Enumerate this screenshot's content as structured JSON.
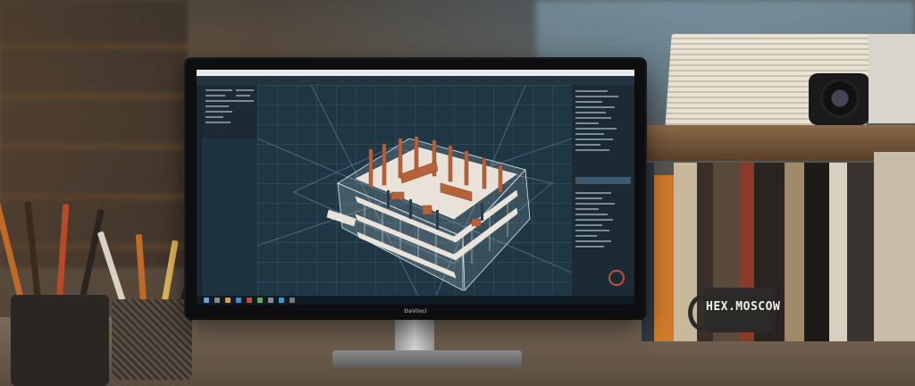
{
  "monitor": {
    "brand": "DaVinci"
  },
  "mug": {
    "text": "HEX.MOSCOW"
  },
  "icons": [
    "building-model-icon",
    "nav-cube-icon",
    "start-icon",
    "pencil-icon",
    "camera-icon"
  ],
  "colors": {
    "screen_bg": "#1f3644",
    "model_wood": "#b8623a",
    "model_frame": "#e8e2d8",
    "accent_red": "#c8503c"
  }
}
